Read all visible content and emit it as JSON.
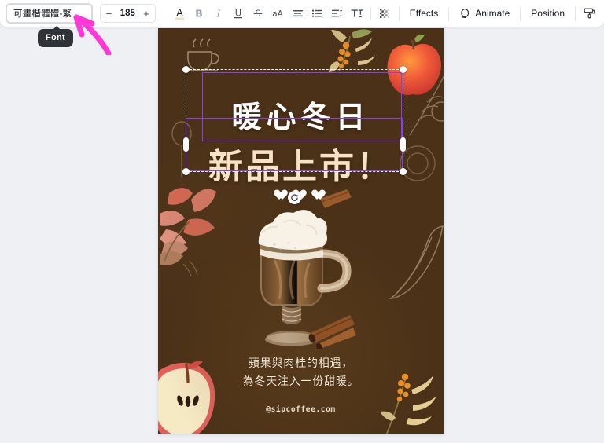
{
  "toolbar": {
    "font_name": "可畫楷體體-繁",
    "font_size": "185",
    "decrease_label": "−",
    "increase_label": "+",
    "text_color_label": "A",
    "bold_label": "B",
    "italic_label": "I",
    "underline_label": "U",
    "strikethrough_label": "S",
    "case_label": "aA",
    "align_icon": "align-left-icon",
    "list_icon": "bullet-list-icon",
    "spacing_icon": "line-spacing-icon",
    "text_fit_icon": "text-fit-icon",
    "transparency_icon": "transparency-checker-icon",
    "effects_label": "Effects",
    "animate_label": "Animate",
    "position_label": "Position",
    "copy_style_icon": "paint-roller-icon",
    "text_color_swatch": "#f0dfc0"
  },
  "tooltip": {
    "label": "Font"
  },
  "cursor": {
    "color": "#ff38d8"
  },
  "poster": {
    "background_color": "#4a3117",
    "title_line1": "暖心冬日",
    "title_line2": "新品上市！",
    "hearts_count": 3,
    "tagline_line1": "蘋果與肉桂的相遇，",
    "tagline_line2": "為冬天注入一份甜暖。",
    "handle": "@sipcoffee.com",
    "title_line1_color": "#ffffff",
    "title_line2_color": "#f7e2c5"
  },
  "selection": {
    "accent_color": "#8b3dff",
    "handle_color": "#ffffff",
    "rotate_icon": "rotate-icon"
  }
}
